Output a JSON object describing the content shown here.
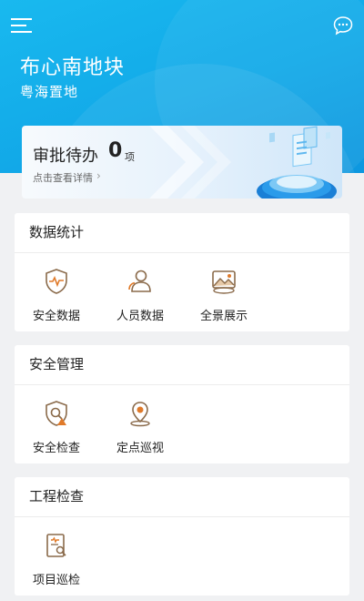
{
  "header": {
    "site_name": "布心南地块",
    "company": "粤海置地",
    "menu_icon": "menu-icon",
    "chat_icon": "chat-icon",
    "background": "#15aeea"
  },
  "approval": {
    "label": "审批待办",
    "count": "0",
    "unit": "项",
    "detail_link": "点击查看详情",
    "chevron": "›"
  },
  "sections": {
    "data_stats": {
      "title": "数据统计",
      "items": [
        {
          "label": "安全数据",
          "icon": "shield-pulse-icon"
        },
        {
          "label": "人员数据",
          "icon": "people-icon"
        },
        {
          "label": "全景展示",
          "icon": "panorama-icon"
        }
      ]
    },
    "safety_mgmt": {
      "title": "安全管理",
      "items": [
        {
          "label": "安全检查",
          "icon": "shield-search-icon"
        },
        {
          "label": "定点巡视",
          "icon": "location-pin-icon"
        }
      ]
    },
    "engineering": {
      "title": "工程检查",
      "items": [
        {
          "label": "项目巡检",
          "icon": "document-search-icon"
        }
      ]
    }
  },
  "colors": {
    "accent_blue": "#15aeea",
    "icon_brown": "#8a6a4a"
  }
}
